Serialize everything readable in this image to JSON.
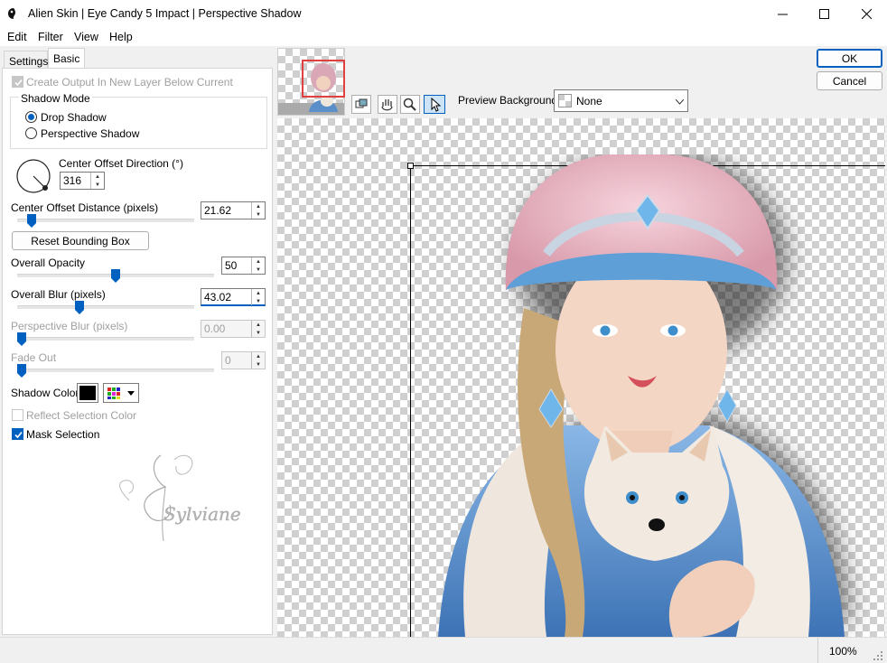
{
  "window": {
    "title": "Alien Skin | Eye Candy 5 Impact | Perspective Shadow",
    "controls": [
      "minimize-icon",
      "maximize-icon",
      "close-icon"
    ]
  },
  "menu": [
    "Edit",
    "Filter",
    "View",
    "Help"
  ],
  "tabs": [
    "Settings",
    "Basic"
  ],
  "basic": {
    "create_output": "Create Output In New Layer Below Current",
    "shadow_mode": {
      "label": "Shadow Mode",
      "options": [
        "Drop Shadow",
        "Perspective Shadow"
      ],
      "selected": "Drop Shadow"
    },
    "center_offset_direction": {
      "label": "Center Offset Direction (°)",
      "value": "316"
    },
    "center_offset_distance": {
      "label": "Center Offset Distance (pixels)",
      "value": "21.62"
    },
    "reset_button": "Reset Bounding Box",
    "overall_opacity": {
      "label": "Overall Opacity",
      "value": "50"
    },
    "overall_blur": {
      "label": "Overall Blur (pixels)",
      "value": "43.02"
    },
    "perspective_blur": {
      "label": "Perspective Blur (pixels)",
      "value": "0.00"
    },
    "fade_out": {
      "label": "Fade Out",
      "value": "0"
    },
    "shadow_color": {
      "label": "Shadow Color",
      "value": "#000000"
    },
    "reflect_selection": "Reflect Selection Color",
    "mask_selection": "Mask Selection",
    "watermark": "Sylviane"
  },
  "buttons": {
    "ok": "OK",
    "cancel": "Cancel"
  },
  "preview": {
    "background_label": "Preview Background:",
    "background_value": "None",
    "tools": [
      "zoom-fit-icon",
      "hand-icon",
      "magnifier-icon",
      "pointer-icon"
    ]
  },
  "status": {
    "zoom": "100%"
  },
  "colors": {
    "accent": "#0060c0",
    "checker": "#cfcfcf"
  }
}
